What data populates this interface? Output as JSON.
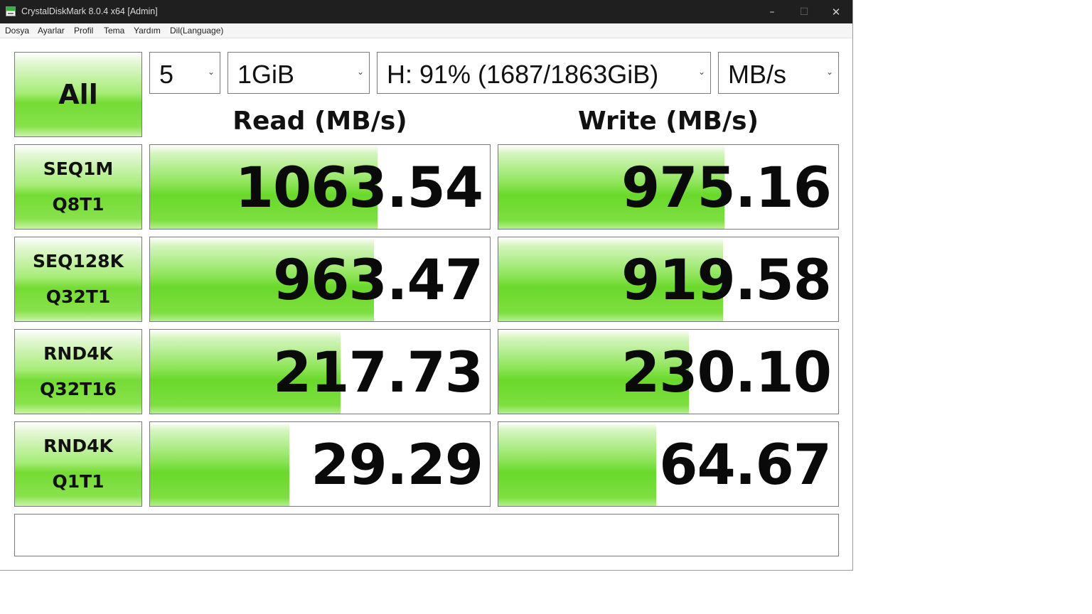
{
  "window": {
    "title": "CrystalDiskMark 8.0.4 x64 [Admin]"
  },
  "titlebar": {
    "minimize": "–",
    "maximize": "☐",
    "close": "✕"
  },
  "menu": [
    "Dosya",
    "Ayarlar",
    "Profil",
    "Tema",
    "Yardım",
    "Dil(Language)"
  ],
  "controls": {
    "all_label": "All",
    "count": "5",
    "size": "1GiB",
    "drive": "H: 91% (1687/1863GiB)",
    "unit": "MB/s",
    "dropdown_glyph": "⌄"
  },
  "headers": {
    "read": "Read (MB/s)",
    "write": "Write (MB/s)"
  },
  "tests": [
    {
      "line1": "SEQ1M",
      "line2": "Q8T1",
      "read": "1063.54",
      "write": "975.16",
      "read_fill": 0.67,
      "write_fill": 0.665
    },
    {
      "line1": "SEQ128K",
      "line2": "Q32T1",
      "read": "963.47",
      "write": "919.58",
      "read_fill": 0.66,
      "write_fill": 0.662
    },
    {
      "line1": "RND4K",
      "line2": "Q32T16",
      "read": "217.73",
      "write": "230.10",
      "read_fill": 0.56,
      "write_fill": 0.56
    },
    {
      "line1": "RND4K",
      "line2": "Q1T1",
      "read": "29.29",
      "write": "64.67",
      "read_fill": 0.41,
      "write_fill": 0.465
    }
  ],
  "colors": {
    "bar_green": "#69d92a",
    "titlebar": "#1f1f1f"
  }
}
